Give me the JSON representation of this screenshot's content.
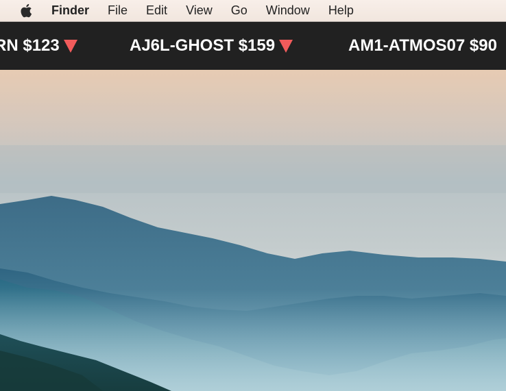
{
  "menubar": {
    "apple_icon": "apple-icon",
    "items": [
      {
        "label": "Finder",
        "bold": true
      },
      {
        "label": "File"
      },
      {
        "label": "Edit"
      },
      {
        "label": "View"
      },
      {
        "label": "Go"
      },
      {
        "label": "Window"
      },
      {
        "label": "Help"
      }
    ]
  },
  "ticker": {
    "items": [
      {
        "symbol": "RN",
        "price": "$123",
        "direction": "down"
      },
      {
        "symbol": "AJ6L-GHOST",
        "price": "$159",
        "direction": "down"
      },
      {
        "symbol": "AM1-ATMOS07",
        "price": "$90",
        "direction": "down"
      }
    ],
    "down_color": "#f25b5b"
  },
  "desktop": {
    "wallpaper": "misty-mountains"
  }
}
